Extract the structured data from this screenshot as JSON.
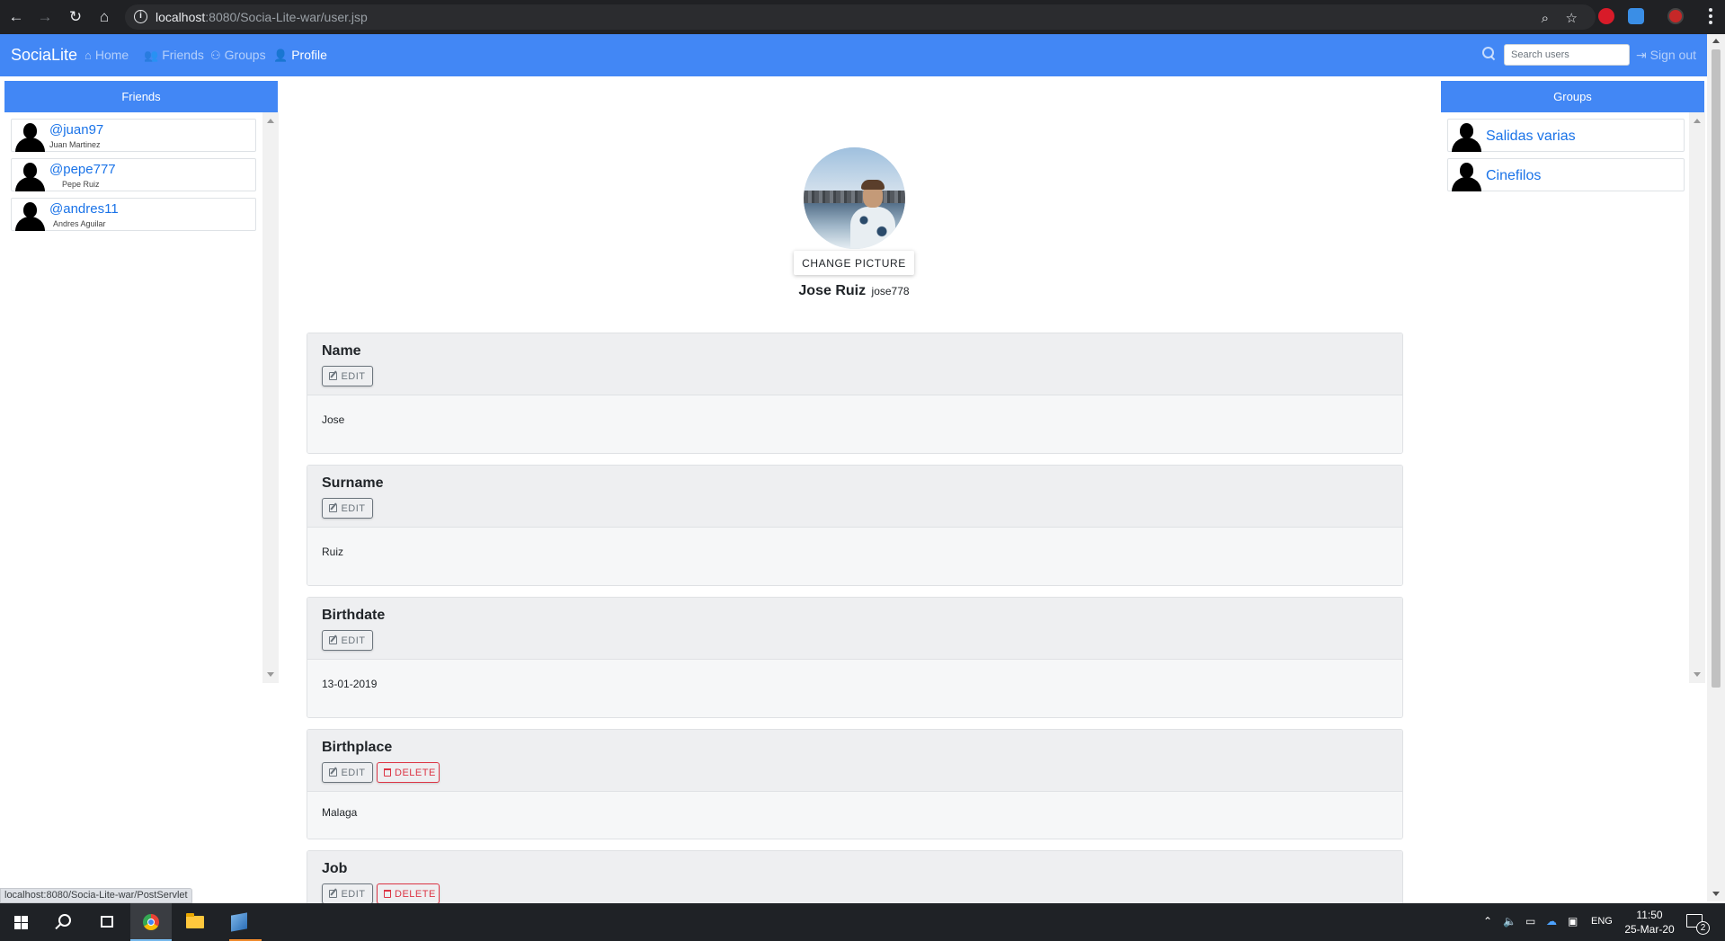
{
  "browser": {
    "url_host": "localhost",
    "url_path": ":8080/Socia-Lite-war/user.jsp",
    "status_link": "localhost:8080/Socia-Lite-war/PostServlet"
  },
  "navbar": {
    "brand": "SociaLite",
    "items": [
      {
        "label": "Home",
        "icon": "home-icon",
        "active": false
      },
      {
        "label": "Friends",
        "icon": "users-icon",
        "active": false
      },
      {
        "label": "Groups",
        "icon": "group-icon",
        "active": false
      },
      {
        "label": "Profile",
        "icon": "user-icon",
        "active": true
      }
    ],
    "search_placeholder": "Search users",
    "signout_label": "Sign out"
  },
  "friends_panel": {
    "title": "Friends",
    "items": [
      {
        "handle": "@juan97",
        "name": "Juan Martinez"
      },
      {
        "handle": "@pepe777",
        "name": "Pepe Ruiz"
      },
      {
        "handle": "@andres11",
        "name": "Andres Aguilar"
      }
    ]
  },
  "groups_panel": {
    "title": "Groups",
    "items": [
      {
        "name": "Salidas varias"
      },
      {
        "name": "Cinefilos"
      }
    ]
  },
  "profile": {
    "change_picture_label": "CHANGE PICTURE",
    "full_name": "Jose Ruiz",
    "username": "jose778"
  },
  "fields": [
    {
      "title": "Name",
      "value": "Jose",
      "edit_label": "EDIT",
      "delete_label": ""
    },
    {
      "title": "Surname",
      "value": "Ruiz",
      "edit_label": "EDIT",
      "delete_label": ""
    },
    {
      "title": "Birthdate",
      "value": "13-01-2019",
      "edit_label": "EDIT",
      "delete_label": ""
    },
    {
      "title": "Birthplace",
      "value": "Malaga",
      "edit_label": "EDIT",
      "delete_label": "DELETE"
    },
    {
      "title": "Job",
      "value": "",
      "edit_label": "EDIT",
      "delete_label": "DELETE"
    }
  ],
  "taskbar": {
    "language": "ENG",
    "time": "11:50",
    "date": "25-Mar-20",
    "notification_count": "2"
  },
  "colors": {
    "navbar": "#4287f5",
    "link": "#1a73e8",
    "danger": "#dc3545",
    "secondary": "#6c757d"
  }
}
